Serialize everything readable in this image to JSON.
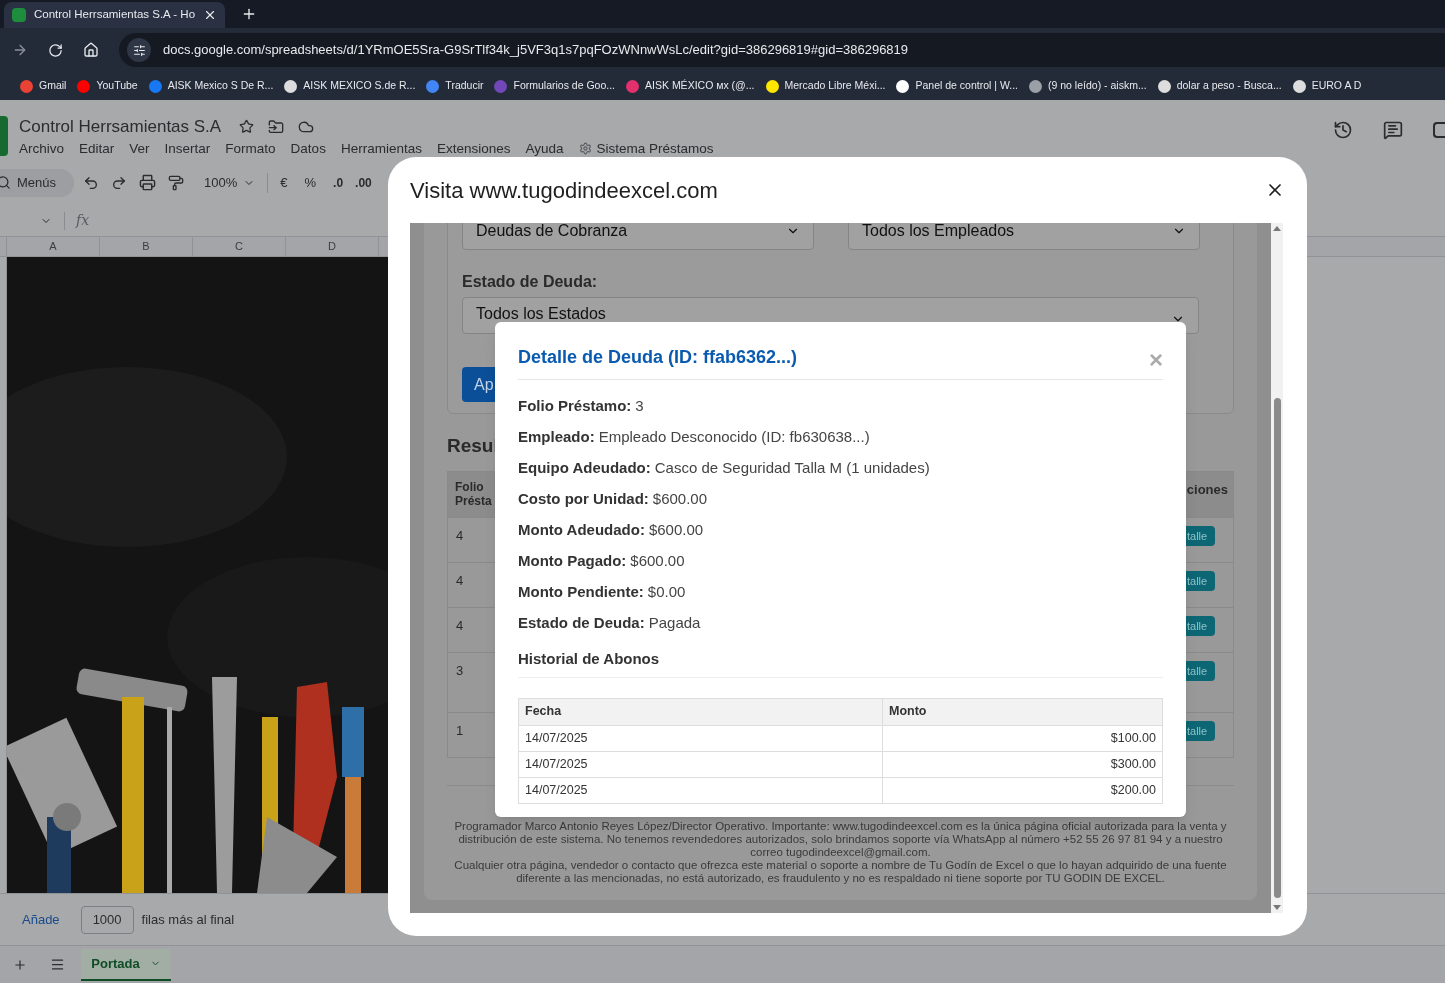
{
  "browser": {
    "tab": {
      "title": "Control Herrsamientas S.A - Ho"
    },
    "url": "docs.google.com/spreadsheets/d/1YRmOE5Sra-G9SrTlf34k_j5VF3q1s7pqFOzWNnwWsLc/edit?gid=386296819#gid=386296819",
    "bookmarks": [
      {
        "label": "Gmail",
        "color": "#ea4335"
      },
      {
        "label": "YouTube",
        "color": "#ff0000"
      },
      {
        "label": "AISK Mexico S De R...",
        "color": "#1877f2"
      },
      {
        "label": "AISK MEXICO S.de R...",
        "color": "#dddddd"
      },
      {
        "label": "Traducir",
        "color": "#4285f4"
      },
      {
        "label": "Formularios de Goo...",
        "color": "#7248b9"
      },
      {
        "label": "AISK MÉXICO ᴍx (@...",
        "color": "#e1306c"
      },
      {
        "label": "Mercado Libre Méxi...",
        "color": "#ffe600"
      },
      {
        "label": "Panel de control | W...",
        "color": "#ffffff"
      },
      {
        "label": "(9 no leído) - aiskm...",
        "color": "#9aa0a6"
      },
      {
        "label": "dolar a peso - Busca...",
        "color": "#dddddd"
      },
      {
        "label": "EURO A D",
        "color": "#dddddd"
      }
    ]
  },
  "sheets": {
    "title": "Control Herrsamientas S.A",
    "menu": [
      "Archivo",
      "Editar",
      "Ver",
      "Insertar",
      "Formato",
      "Datos",
      "Herramientas",
      "Extensiones",
      "Ayuda"
    ],
    "addon_menu": "Sistema Préstamos",
    "toolbar": {
      "search": "Menús",
      "zoom": "100%",
      "currency": "€",
      "percent": "%",
      "decrease_decimals": ".0",
      "increase_decimals": ".00"
    },
    "formula_label": "fx",
    "columns": [
      "A",
      "B",
      "C",
      "D"
    ],
    "add_rows": {
      "button": "Añade",
      "value": "1000",
      "suffix": "filas más al final"
    },
    "sheet_tabs": [
      {
        "label": "Portada",
        "selected": true
      }
    ]
  },
  "dialog": {
    "title": "Visita www.tugodindeexcel.com",
    "page": {
      "filters": [
        "Deudas de Cobranza",
        "Todos los Empleados"
      ],
      "status_label": "Estado de Deuda:",
      "status_value": "Todos los Estados",
      "apply_button": "Ap",
      "results_heading": "Resul",
      "table": {
        "column_1": "Folio Présta",
        "column_2": "ciones",
        "rows": [
          {
            "folio": "4",
            "action": "talle"
          },
          {
            "folio": "4",
            "action": "talle"
          },
          {
            "folio": "4",
            "action": "talle"
          },
          {
            "folio": "3",
            "action": "talle"
          },
          {
            "folio": "1",
            "action": "talle"
          }
        ]
      },
      "footer": [
        "Programador Marco Antonio Reyes López/Director Operativo. Importante: www.tugodindeexcel.com es la única página oficial autorizada para la venta y distribución de este sistema. No tenemos revendedores autorizados, solo brindamos soporte vía WhatsApp al número +52 55 26 97 81 94 y a nuestro correo tugodindeexcel@gmail.com.",
        "Cualquier otra página, vendedor o contacto que ofrezca este material o soporte a nombre de Tu Godín de Excel o que lo hayan adquirido de una fuente diferente a las mencionadas, no está autorizado, es fraudulento y no es respaldado ni tiene soporte por TU GODIN DE EXCEL."
      ]
    },
    "detail": {
      "title": "Detalle de Deuda (ID: ffab6362...)",
      "close": "×",
      "fields": [
        {
          "label": "Folio Préstamo:",
          "value": "3"
        },
        {
          "label": "Empleado:",
          "value": "Empleado Desconocido (ID: fb630638...)"
        },
        {
          "label": "Equipo Adeudado:",
          "value": "Casco de Seguridad Talla M (1 unidades)"
        },
        {
          "label": "Costo por Unidad:",
          "value": "$600.00"
        },
        {
          "label": "Monto Adeudado:",
          "value": "$600.00"
        },
        {
          "label": "Monto Pagado:",
          "value": "$600.00"
        },
        {
          "label": "Monto Pendiente:",
          "value": "$0.00"
        },
        {
          "label": "Estado de Deuda:",
          "value": "Pagada"
        }
      ],
      "history_title": "Historial de Abonos",
      "history": {
        "columns": [
          "Fecha",
          "Monto"
        ],
        "rows": [
          {
            "date": "14/07/2025",
            "amount": "$100.00"
          },
          {
            "date": "14/07/2025",
            "amount": "$300.00"
          },
          {
            "date": "14/07/2025",
            "amount": "$200.00"
          }
        ]
      }
    }
  }
}
